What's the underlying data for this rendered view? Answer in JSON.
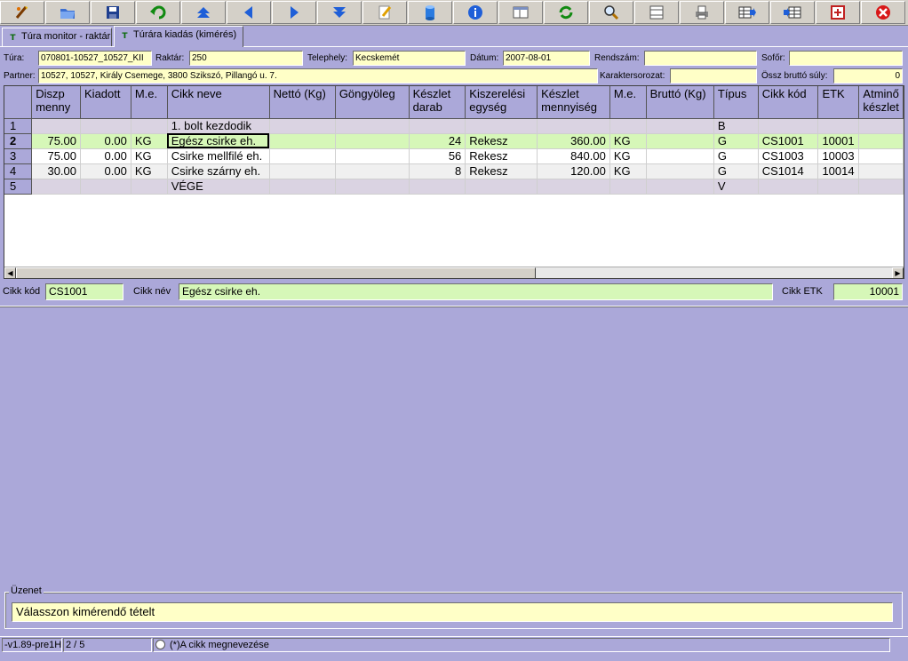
{
  "toolbar": {
    "buttons": [
      {
        "name": "exit-wizard-icon"
      },
      {
        "name": "open-folder-icon"
      },
      {
        "name": "save-disk-icon"
      },
      {
        "name": "undo-arrow-icon"
      },
      {
        "name": "first-record-icon"
      },
      {
        "name": "previous-record-icon"
      },
      {
        "name": "next-record-icon"
      },
      {
        "name": "last-record-icon"
      },
      {
        "name": "edit-note-icon"
      },
      {
        "name": "database-icon"
      },
      {
        "name": "info-icon"
      },
      {
        "name": "window-layout-icon"
      },
      {
        "name": "refresh-icon"
      },
      {
        "name": "search-magnifier-icon"
      },
      {
        "name": "column-width-icon"
      },
      {
        "name": "printer-icon"
      },
      {
        "name": "table-export-icon"
      },
      {
        "name": "table-import-icon"
      },
      {
        "name": "maximize-window-icon"
      },
      {
        "name": "close-red-icon"
      }
    ]
  },
  "tabs": [
    {
      "label": "Túra monitor - raktár",
      "active": false
    },
    {
      "label": "Túrára kiadás (kimérés)",
      "active": true
    }
  ],
  "header": {
    "tura": {
      "label": "Túra:",
      "value": "070801-10527_10527_KII"
    },
    "raktar": {
      "label": "Raktár:",
      "value": "250"
    },
    "telephely": {
      "label": "Telephely:",
      "value": "Kecskemét"
    },
    "datum": {
      "label": "Dátum:",
      "value": "2007-08-01"
    },
    "rendszam": {
      "label": "Rendszám:",
      "value": ""
    },
    "sofor": {
      "label": "Sofőr:",
      "value": ""
    },
    "partner": {
      "label": "Partner:",
      "value": "10527, 10527, Király Csemege, 3800 Szikszó, Pillangó u. 7."
    },
    "karaktersorozat": {
      "label": "Karaktersorozat:",
      "value": ""
    },
    "ossz_brutto": {
      "label": "Össz bruttó súly:",
      "value": "0"
    }
  },
  "grid": {
    "columns": [
      "Diszp menny",
      "Kiadott",
      "M.e.",
      "Cikk neve",
      "Nettó (Kg)",
      "Göngyöleg",
      "Készlet darab",
      "Kiszerelési egység",
      "Készlet mennyiség",
      "M.e.",
      "Bruttó (Kg)",
      "Típus",
      "Cikk kód",
      "ETK",
      "Atminő készlet"
    ],
    "rows": [
      {
        "rn": "1",
        "style": "sep",
        "cells": [
          "",
          "",
          "",
          "1. bolt kezdodik",
          "",
          "",
          "",
          "",
          "",
          "",
          "",
          "B",
          "",
          "",
          ""
        ]
      },
      {
        "rn": "2",
        "style": "sel",
        "cells": [
          "75.00",
          "0.00",
          "KG",
          "Egész csirke eh.",
          "",
          "",
          "24",
          "Rekesz",
          "360.00",
          "KG",
          "",
          "G",
          "CS1001",
          "10001",
          ""
        ]
      },
      {
        "rn": "3",
        "style": "wht",
        "cells": [
          "75.00",
          "0.00",
          "KG",
          "Csirke mellfilé eh.",
          "",
          "",
          "56",
          "Rekesz",
          "840.00",
          "KG",
          "",
          "G",
          "CS1003",
          "10003",
          ""
        ]
      },
      {
        "rn": "4",
        "style": "alt",
        "cells": [
          "30.00",
          "0.00",
          "KG",
          "Csirke szárny eh.",
          "",
          "",
          "8",
          "Rekesz",
          "120.00",
          "KG",
          "",
          "G",
          "CS1014",
          "10014",
          ""
        ]
      },
      {
        "rn": "5",
        "style": "sep",
        "cells": [
          "",
          "",
          "",
          "VÉGE",
          "",
          "",
          "",
          "",
          "",
          "",
          "",
          "V",
          "",
          "",
          ""
        ]
      }
    ]
  },
  "detail": {
    "cikk_kod": {
      "label": "Cikk kód",
      "value": "CS1001"
    },
    "cikk_nev": {
      "label": "Cikk név",
      "value": "Egész csirke eh."
    },
    "cikk_etk": {
      "label": "Cikk ETK",
      "value": "10001"
    }
  },
  "message": {
    "title": "Üzenet",
    "text": "Válasszon kimérendő tételt"
  },
  "status": {
    "version": "-v1.89-pre1H",
    "position": "2 / 5",
    "hint": "(*)A cikk megnevezése"
  }
}
